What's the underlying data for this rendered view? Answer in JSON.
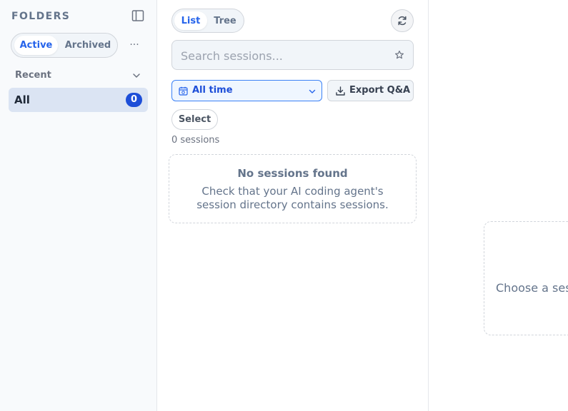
{
  "sidebar": {
    "title": "FOLDERS",
    "tabs": {
      "active": "Active",
      "archived": "Archived"
    },
    "more": "···",
    "section": "Recent",
    "folder": {
      "label": "All",
      "count": "0"
    }
  },
  "sessions": {
    "view_tabs": {
      "list": "List",
      "tree": "Tree"
    },
    "search": {
      "placeholder": "Search sessions..."
    },
    "time_filter": "All time",
    "export_label": "Export Q&A",
    "select_label": "Select",
    "count_text": "0 sessions",
    "empty": {
      "title": "No sessions found",
      "description": "Check that your AI coding agent's session directory contains sessions."
    }
  },
  "detail": {
    "placeholder": "Choose a session"
  },
  "colors": {
    "accent": "#2563eb",
    "badge": "#1d4ed8",
    "selected_row": "#dbe4f3"
  }
}
